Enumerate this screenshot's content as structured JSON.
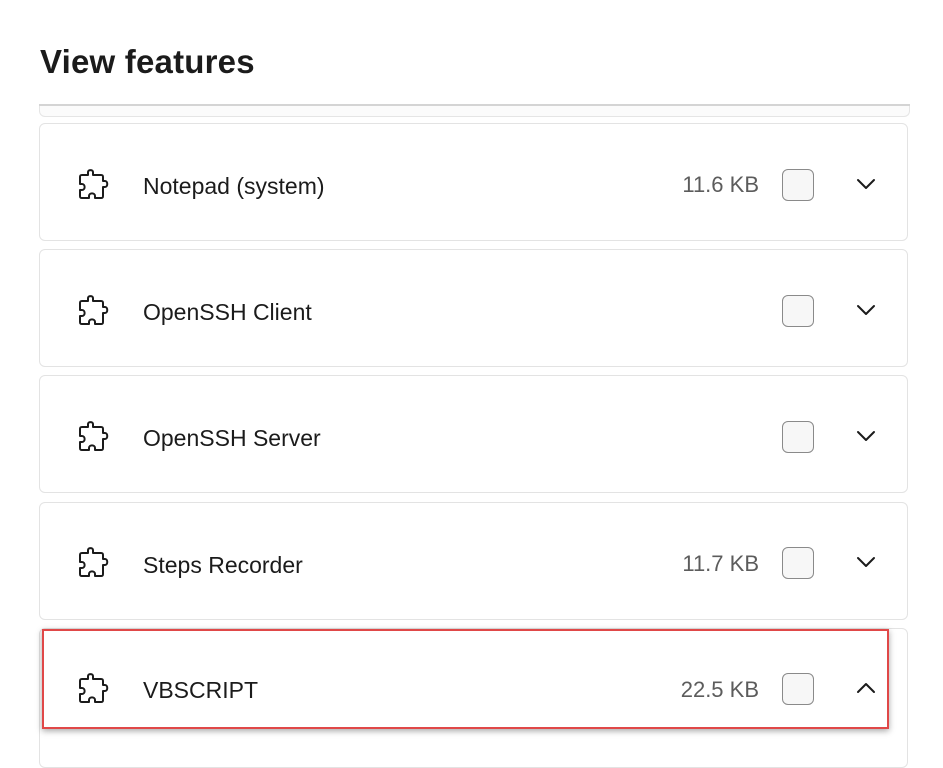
{
  "page": {
    "title": "View features"
  },
  "features": [
    {
      "name": "Notepad (system)",
      "size": "11.6 KB",
      "checked": false,
      "expanded": false,
      "icon": "puzzle-piece-icon"
    },
    {
      "name": "OpenSSH Client",
      "size": "",
      "checked": false,
      "expanded": false,
      "icon": "puzzle-piece-icon"
    },
    {
      "name": "OpenSSH Server",
      "size": "",
      "checked": false,
      "expanded": false,
      "icon": "puzzle-piece-icon"
    },
    {
      "name": "Steps Recorder",
      "size": "11.7 KB",
      "checked": false,
      "expanded": false,
      "icon": "puzzle-piece-icon"
    },
    {
      "name": "VBSCRIPT",
      "size": "22.5 KB",
      "checked": false,
      "expanded": true,
      "icon": "puzzle-piece-icon",
      "highlighted": true
    }
  ],
  "colors": {
    "highlight": "#e04848",
    "text_primary": "#1b1b1b",
    "text_secondary": "#5c5c5c",
    "card_border": "#e3e3e3"
  }
}
